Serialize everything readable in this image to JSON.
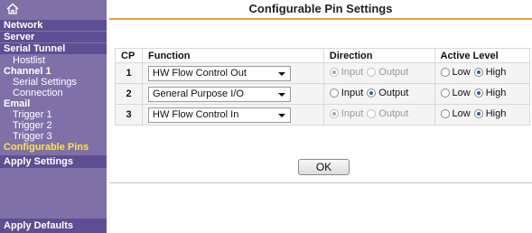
{
  "sidebar": {
    "items": [
      {
        "label": "Network"
      },
      {
        "label": "Server"
      },
      {
        "label": "Serial Tunnel"
      },
      {
        "label": "Hostlist"
      },
      {
        "label": "Channel 1"
      },
      {
        "label": "Serial Settings"
      },
      {
        "label": "Connection"
      },
      {
        "label": "Email"
      },
      {
        "label": "Trigger 1"
      },
      {
        "label": "Trigger 2"
      },
      {
        "label": "Trigger 3"
      },
      {
        "label": "Configurable Pins"
      },
      {
        "label": "Apply Settings"
      },
      {
        "label": "Apply Defaults"
      }
    ]
  },
  "page": {
    "title": "Configurable Pin Settings"
  },
  "table": {
    "headers": [
      "CP",
      "Function",
      "Direction",
      "Active Level"
    ],
    "rows": [
      {
        "cp": "1",
        "function": "HW Flow Control Out",
        "direction": {
          "input": "Input",
          "output": "Output",
          "selected": "Input",
          "disabled": true
        },
        "level": {
          "low": "Low",
          "high": "High",
          "selected": "High"
        }
      },
      {
        "cp": "2",
        "function": "General Purpose I/O",
        "direction": {
          "input": "Input",
          "output": "Output",
          "selected": "Output",
          "disabled": false
        },
        "level": {
          "low": "Low",
          "high": "High",
          "selected": "High"
        }
      },
      {
        "cp": "3",
        "function": "HW Flow Control In",
        "direction": {
          "input": "Input",
          "output": "Output",
          "selected": "Input",
          "disabled": true
        },
        "level": {
          "low": "Low",
          "high": "High",
          "selected": "High"
        }
      }
    ]
  },
  "actions": {
    "ok_label": "OK"
  },
  "colors": {
    "sidebar_bg": "#7f71a8",
    "section_bg": "#5e4e94",
    "active_text": "#ffe14d",
    "title_underline": "#e8a23a"
  },
  "icons": {
    "home": "home-icon",
    "dropdown": "chevron-down-icon"
  }
}
